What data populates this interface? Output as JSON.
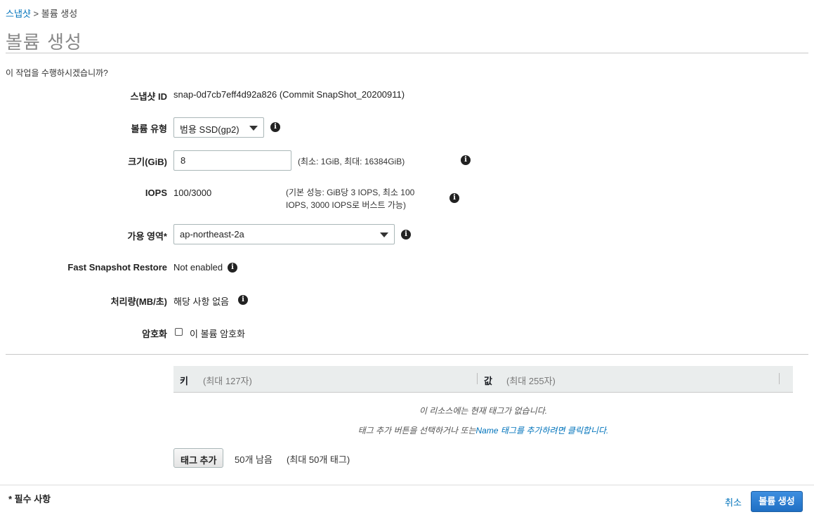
{
  "breadcrumb": {
    "parent": "스냅샷",
    "separator": ">",
    "current": "볼륨 생성"
  },
  "title": "볼륨 생성",
  "question": "이 작업을 수행하시겠습니까?",
  "form": {
    "snapshot": {
      "label": "스냅샷 ID",
      "value": "snap-0d7cb7eff4d92a826 (Commit SnapShot_20200911)"
    },
    "volume_type": {
      "label": "볼륨 유형",
      "selected": "범용 SSD(gp2)"
    },
    "size": {
      "label": "크기(GiB)",
      "value": "8",
      "hint": "(최소: 1GiB, 최대: 16384GiB)"
    },
    "iops": {
      "label": "IOPS",
      "value": "100/3000",
      "hint_line1": "(기본 성능: GiB당 3 IOPS, 최소 100",
      "hint_line2": "IOPS, 3000 IOPS로 버스트 가능)"
    },
    "az": {
      "label": "가용 영역*",
      "selected": "ap-northeast-2a"
    },
    "fsr": {
      "label": "Fast Snapshot Restore",
      "value": "Not enabled"
    },
    "throughput": {
      "label": "처리량(MB/초)",
      "value": "해당 사항 없음"
    },
    "encryption": {
      "label": "암호화",
      "checkbox_label": "이 볼륨 암호화",
      "checked": false
    }
  },
  "tags": {
    "key_header": "키",
    "key_hint": "(최대 127자)",
    "value_header": "값",
    "value_hint": "(최대 255자)",
    "empty_line1": "이 리소스에는 현재 태그가 없습니다.",
    "empty_line2_prefix": "태그 추가 버튼을 선택하거나 또는",
    "empty_line2_link": "Name 태그를 추가하려면 클릭합니다.",
    "add_button": "태그 추가",
    "remaining": "50개 남음",
    "max": "(최대 50개 태그)"
  },
  "footer": {
    "required": "* 필수 사항",
    "cancel": "취소",
    "submit": "볼륨 생성"
  },
  "icons": {
    "info": "info-icon",
    "caret": "caret-down-icon"
  },
  "colors": {
    "link": "#0073bb",
    "primary": "#1f6fc4"
  }
}
